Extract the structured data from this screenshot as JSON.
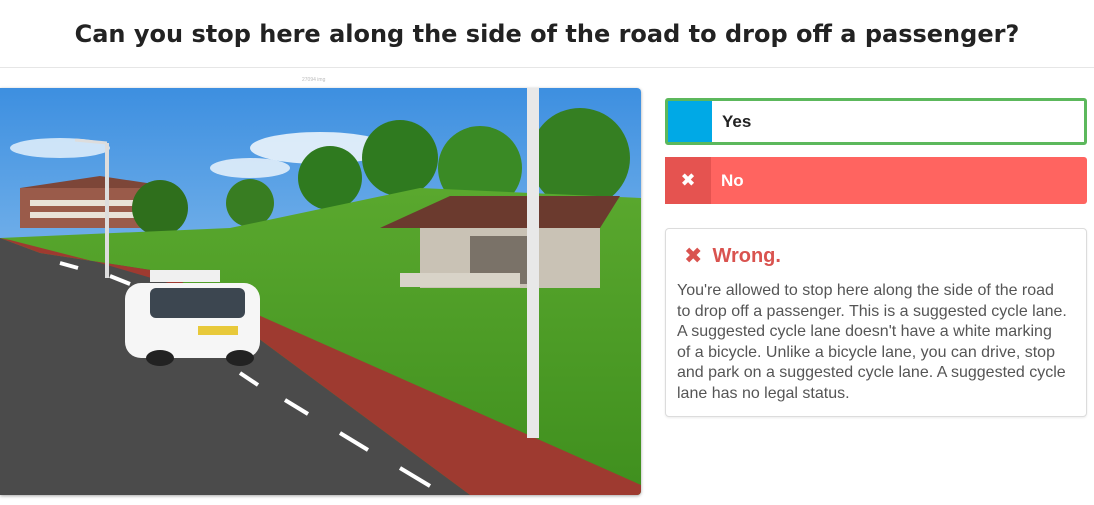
{
  "question": "Can you stop here along the side of the road to drop off a passenger?",
  "image_caption": "27094 img",
  "answers": [
    {
      "label": "Yes",
      "state": "selected-correct",
      "marker_color": "#00a9e6"
    },
    {
      "label": "No",
      "state": "wrong",
      "marker_icon": "close-icon",
      "marker_symbol": "✖"
    }
  ],
  "feedback": {
    "icon": "close-icon",
    "icon_symbol": "✖",
    "title": "Wrong.",
    "text": "You're allowed to stop here along the side of the road to drop off a passenger. This is a suggested cycle lane. A suggested cycle lane doesn't have a white marking of a bicycle. Unlike a bicycle lane, you can drive, stop and park on a suggested cycle lane. A suggested cycle lane has no legal status."
  },
  "colors": {
    "correct_border": "#5cb85c",
    "wrong_bg": "#ff6460",
    "wrong_text": "#d9534f"
  }
}
